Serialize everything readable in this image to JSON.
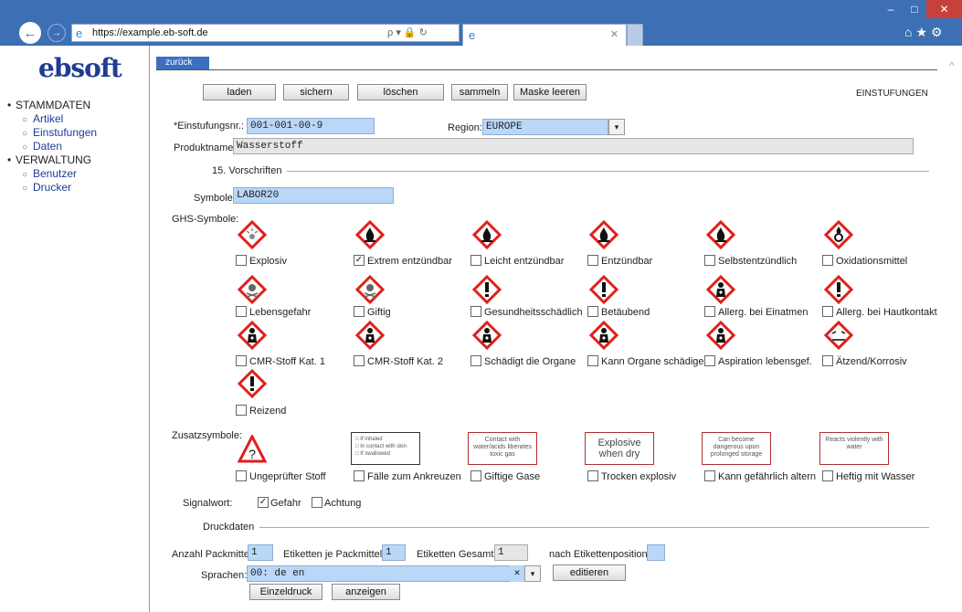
{
  "browser": {
    "url": "https://example.eb-soft.de",
    "tools": "ρ ▾ 🔒 ↻"
  },
  "sidebar": {
    "logo": "ebsoft",
    "groups": [
      {
        "label": "STAMMDATEN",
        "items": [
          "Artikel",
          "Einstufungen",
          "Daten"
        ]
      },
      {
        "label": "VERWALTUNG",
        "items": [
          "Benutzer",
          "Drucker"
        ]
      }
    ]
  },
  "tab_back": "zurück",
  "toolbar": {
    "buttons": [
      "laden",
      "sichern",
      "löschen",
      "sammeln",
      "Maske leeren"
    ],
    "page_title": "EINSTUFUNGEN"
  },
  "form": {
    "einstufungsnr_label": "*Einstufungsnr.:",
    "einstufungsnr": "001-001-00-9",
    "region_label": "Region:",
    "region": "EUROPE",
    "produktname_label": "Produktname:",
    "produktname": "Wasserstoff",
    "section_vorschriften": "15. Vorschriften",
    "symbole_label": "Symbole:",
    "symbole": "LABOR20",
    "ghs_label": "GHS-Symbole:",
    "ghs": [
      {
        "label": "Explosiv",
        "checked": false,
        "icon": "exploding-bomb-icon"
      },
      {
        "label": "Extrem entzündbar",
        "checked": true,
        "icon": "flame-icon"
      },
      {
        "label": "Leicht entzündbar",
        "checked": false,
        "icon": "flame-icon"
      },
      {
        "label": "Entzündbar",
        "checked": false,
        "icon": "flame-icon"
      },
      {
        "label": "Selbstentzündlich",
        "checked": false,
        "icon": "flame-icon"
      },
      {
        "label": "Oxidationsmittel",
        "checked": false,
        "icon": "flame-over-circle-icon"
      },
      {
        "label": "Lebensgefahr",
        "checked": false,
        "icon": "skull-icon"
      },
      {
        "label": "Giftig",
        "checked": false,
        "icon": "skull-icon"
      },
      {
        "label": "Gesundheitsschädlich",
        "checked": false,
        "icon": "exclamation-icon"
      },
      {
        "label": "Betäubend",
        "checked": false,
        "icon": "exclamation-icon"
      },
      {
        "label": "Allerg. bei Einatmen",
        "checked": false,
        "icon": "health-hazard-icon"
      },
      {
        "label": "Allerg. bei Hautkontakt",
        "checked": false,
        "icon": "exclamation-icon"
      },
      {
        "label": "CMR-Stoff Kat. 1",
        "checked": false,
        "icon": "health-hazard-icon"
      },
      {
        "label": "CMR-Stoff Kat. 2",
        "checked": false,
        "icon": "health-hazard-icon"
      },
      {
        "label": "Schädigt die Organe",
        "checked": false,
        "icon": "health-hazard-icon"
      },
      {
        "label": "Kann Organe schädigen",
        "checked": false,
        "icon": "health-hazard-icon"
      },
      {
        "label": "Aspiration lebensgef.",
        "checked": false,
        "icon": "health-hazard-icon"
      },
      {
        "label": "Ätzend/Korrosiv",
        "checked": false,
        "icon": "corrosion-icon"
      },
      {
        "label": "Reizend",
        "checked": false,
        "icon": "exclamation-icon"
      }
    ],
    "zusatz_label": "Zusatzsymbole:",
    "zusatz": [
      {
        "label": "Ungeprüfter Stoff",
        "symbol": "?"
      },
      {
        "label": "Fälle zum Ankreuzen",
        "symbol_lines": [
          "If inhaled",
          "In contact with skin",
          "If swallowed"
        ]
      },
      {
        "label": "Giftige Gase",
        "symbol": "Contact with water/acids liberates toxic gas"
      },
      {
        "label": "Trocken explosiv",
        "symbol": "Explosive when dry"
      },
      {
        "label": "Kann gefährlich altern",
        "symbol": "Can become dangerous upon prolonged storage"
      },
      {
        "label": "Heftig mit Wasser",
        "symbol": "Reacts violently with water"
      }
    ],
    "signalwort_label": "Signalwort:",
    "signalwort": [
      {
        "label": "Gefahr",
        "checked": true
      },
      {
        "label": "Achtung",
        "checked": false
      }
    ],
    "section_druckdaten": "Druckdaten",
    "anzahl_label": "Anzahl Packmittel:",
    "anzahl": "1",
    "etik_je_label": "Etiketten je Packmittel:",
    "etik_je": "1",
    "etik_gesamt_label": "Etiketten Gesamt:",
    "etik_gesamt": "1",
    "nach_label": "nach Etikettenposition:",
    "nach": "",
    "sprachen_label": "Sprachen:",
    "sprachen": "00: de en",
    "editieren": "editieren",
    "einzeldruck": "Einzeldruck",
    "anzeigen": "anzeigen"
  },
  "colors": {
    "accent": "#3d6fb4",
    "input_bg": "#b9d7f7",
    "hazard_red": "#e0201b"
  }
}
